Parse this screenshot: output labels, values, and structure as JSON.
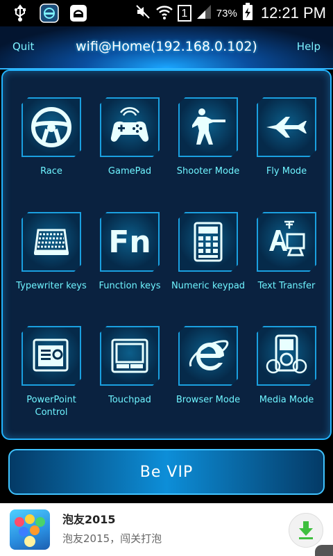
{
  "status_bar": {
    "battery_percent": "73%",
    "signal_label": "1",
    "time": "12:21 PM",
    "icons": [
      "usb-icon",
      "app-icon",
      "store-icon",
      "mute-icon",
      "wifi-icon",
      "sim-icon",
      "signal-icon",
      "charging-icon"
    ]
  },
  "header": {
    "quit_label": "Quit",
    "title": "wifi@Home(192.168.0.102)",
    "help_label": "Help"
  },
  "tiles": [
    {
      "label": "Race",
      "icon": "steering-wheel-icon"
    },
    {
      "label": "GamePad",
      "icon": "gamepad-icon"
    },
    {
      "label": "Shooter Mode",
      "icon": "shooter-icon"
    },
    {
      "label": "Fly Mode",
      "icon": "jet-icon"
    },
    {
      "label": "Typewriter keys",
      "icon": "keyboard-icon"
    },
    {
      "label": "Function keys",
      "icon": "fn-icon"
    },
    {
      "label": "Numeric keypad",
      "icon": "calculator-icon"
    },
    {
      "label": "Text Transfer",
      "icon": "text-transfer-icon"
    },
    {
      "label": "PowerPoint Control",
      "icon": "powerpoint-icon"
    },
    {
      "label": "Touchpad",
      "icon": "touchpad-icon"
    },
    {
      "label": "Browser Mode",
      "icon": "browser-icon"
    },
    {
      "label": "Media Mode",
      "icon": "media-player-icon"
    }
  ],
  "fn_icon_text": "Fn",
  "vip_label": "Be VIP",
  "ad": {
    "title": "泡友2015",
    "subtitle": "泡友2015，闯关打泡",
    "download_icon": "download-icon"
  },
  "colors": {
    "accent": "#22b4ff",
    "label": "#6ff4ff",
    "panel_bg": "#0a2240"
  }
}
